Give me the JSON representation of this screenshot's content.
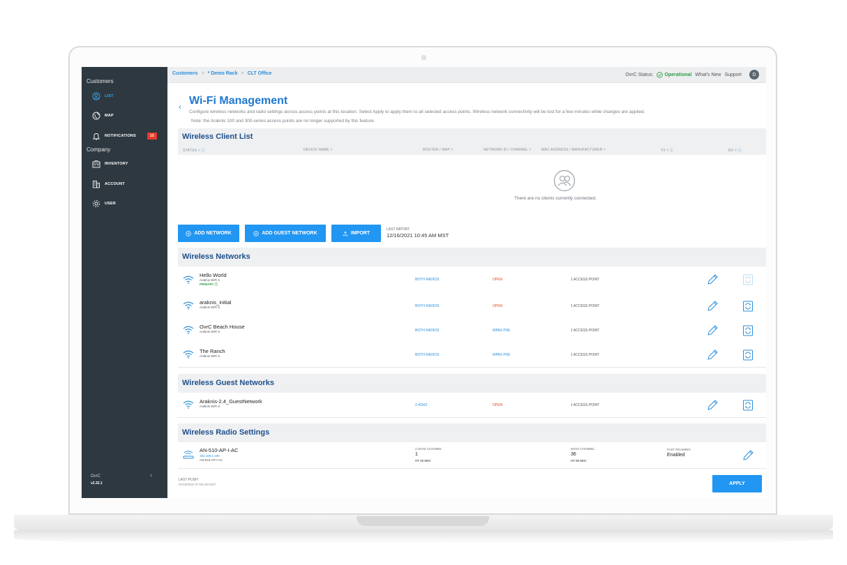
{
  "colors": {
    "accent": "#2196f3",
    "sidebar_bg": "#2d3840",
    "link": "#2b8ed9",
    "ok": "#2ea043",
    "open": "#e04a2f",
    "badge": "#e63c2b"
  },
  "sidebar": {
    "customers_label": "Customers",
    "company_label": "Company",
    "items": [
      {
        "label": "LIST",
        "icon": "user-circle-icon"
      },
      {
        "label": "MAP",
        "icon": "globe-icon"
      },
      {
        "label": "NOTIFICATIONS",
        "icon": "bell-icon",
        "badge": "15"
      },
      {
        "label": "INVENTORY",
        "icon": "inventory-icon"
      },
      {
        "label": "ACCOUNT",
        "icon": "building-icon"
      },
      {
        "label": "USER",
        "icon": "gear-icon"
      }
    ],
    "footer_name": "OvrC",
    "footer_version": "v2.32.1"
  },
  "topbar": {
    "breadcrumbs": [
      "Customers",
      "* Demo Rack",
      "CLT Office"
    ],
    "status_label": "OvrC Status:",
    "status_value": "Operational",
    "whats_new": "What's New",
    "support": "Support",
    "avatar": "D"
  },
  "page": {
    "title": "Wi-Fi Management",
    "description": "Configure wireless networks and radio settings across access points at this location. Select Apply to apply them to all selected access points. Wireless network connectivity will be lost for a few minutes while changes are applied.",
    "note": "Note: the Araknis 100 and 300-series access points are no longer supported by this feature."
  },
  "client_list": {
    "title": "Wireless Client List",
    "columns": [
      "STATUS ˅",
      "DEVICE NAME ˅",
      "ROUTER / WAP ˅",
      "NETWORK ID / CHANNEL ˅",
      "MAC ADDRESS / MANUFACTURER ˅",
      "TX ˅",
      "RX ˅"
    ],
    "empty_text": "There are no clients currently connected."
  },
  "actions": {
    "add_network": "ADD NETWORK",
    "add_guest_network": "ADD GUEST NETWORK",
    "import": "IMPORT",
    "last_import_label": "LAST IMPORT",
    "last_import_value": "12/16/2021 10:45 AM MST"
  },
  "wireless_networks": {
    "title": "Wireless Networks",
    "rows": [
      {
        "name": "Hello World",
        "sub": "Araknis WiFi 5",
        "primary": "PRIMARY ⓘ",
        "radios": "BOTH RADIOS",
        "security": "OPEN",
        "aps": "1 ACCESS POINT"
      },
      {
        "name": "araknis_initial",
        "sub": "Araknis WiFi 5",
        "primary": "",
        "radios": "BOTH RADIOS",
        "security": "OPEN",
        "aps": "1 ACCESS POINT"
      },
      {
        "name": "OvrC Beach House",
        "sub": "Araknis WiFi 5",
        "primary": "",
        "radios": "BOTH RADIOS",
        "security": "WPA2-PSK",
        "aps": "1 ACCESS POINT"
      },
      {
        "name": "The Ranch",
        "sub": "Araknis WiFi 5",
        "primary": "",
        "radios": "BOTH RADIOS",
        "security": "WPA2-PSK",
        "aps": "1 ACCESS POINT"
      }
    ]
  },
  "guest_networks": {
    "title": "Wireless Guest Networks",
    "rows": [
      {
        "name": "Araknis-2.4_GuestNetwork",
        "sub": "Araknis WiFi 5",
        "radios": "2.4GHZ",
        "security": "OPEN",
        "aps": "1 ACCESS POINT"
      }
    ]
  },
  "radio_settings": {
    "title": "Wireless Radio Settings",
    "device_name": "AN-510-AP-I-AC",
    "device_ip": "192.168.1.190",
    "device_model": "AN-510-AP-I-AC",
    "ch24_label": "2.4GHZ CHANNEL",
    "ch24_value": "1",
    "ch24_width": "HT 20 MHz",
    "ch5_label": "5GHZ CHANNEL",
    "ch5_value": "36",
    "ch5_width": "HT 80 MHz",
    "fast_roam_label": "FAST ROAMING",
    "fast_roam_value": "Enabled"
  },
  "footer": {
    "last_push_label": "LAST PUSH",
    "last_push_value": "01/19/2022 07:09 AM MST",
    "apply": "APPLY"
  }
}
